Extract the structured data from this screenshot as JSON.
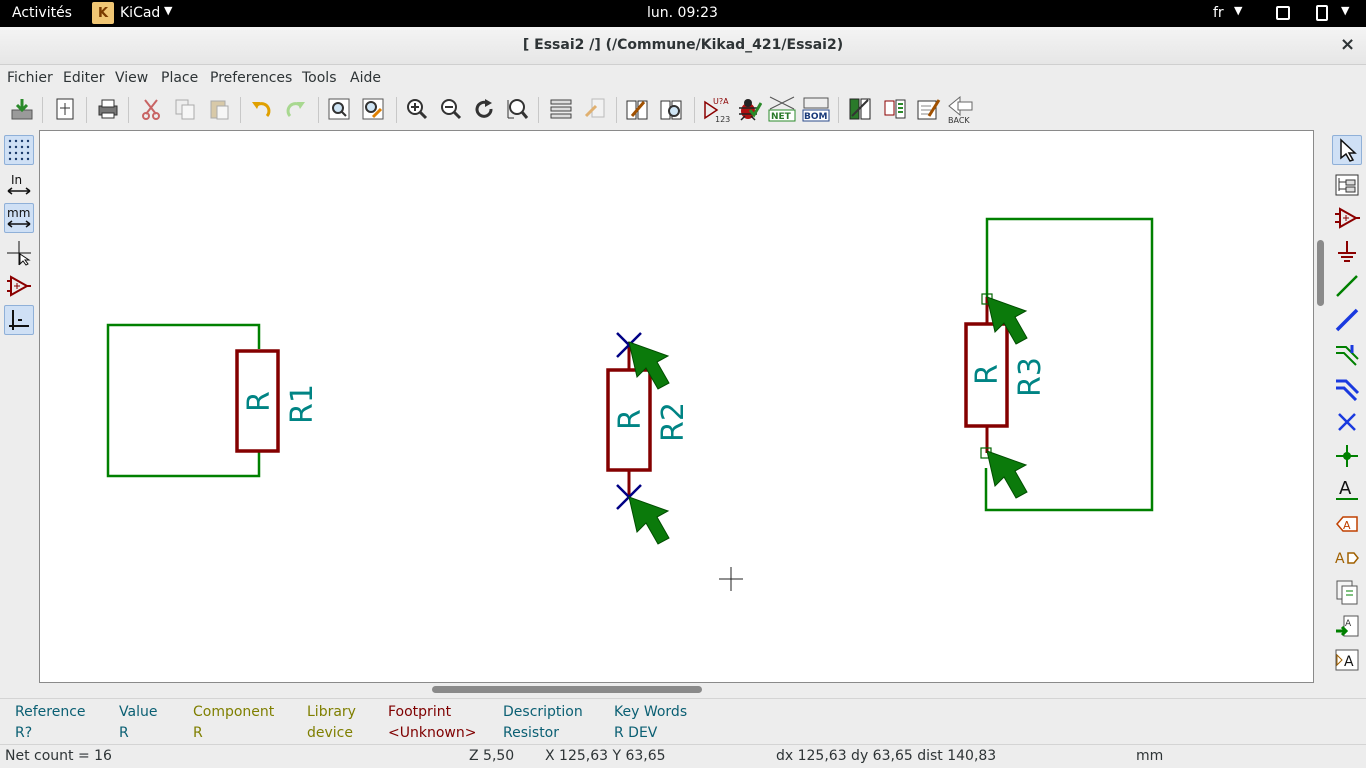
{
  "topbar": {
    "activities": "Activités",
    "app_name": "KiCad",
    "clock": "lun. 09:23",
    "language": "fr"
  },
  "window": {
    "title": "[ Essai2 /] (/Commune/Kikad_421/Essai2)",
    "close_glyph": "×"
  },
  "menu": [
    "Fichier",
    "Editer",
    "View",
    "Place",
    "Preferences",
    "Tools",
    "Aide"
  ],
  "toolbar": {
    "annotate_top": "U?A",
    "annotate_bottom": "123",
    "netlist_label": "NET",
    "bom_label": "BOM",
    "back_label": "BACK"
  },
  "left_toolbar": {
    "inch_label": "In",
    "mm_label": "mm"
  },
  "right_toolbar": {
    "text_label": "A",
    "text_label2": "A"
  },
  "schematic": {
    "components": [
      {
        "reference": "R1",
        "value": "R"
      },
      {
        "reference": "R2",
        "value": "R"
      },
      {
        "reference": "R3",
        "value": "R"
      }
    ],
    "colors": {
      "wire": "#008000",
      "body": "#840000",
      "field_text": "#008484",
      "no_connect": "#000084",
      "erc_arrow": "#006400"
    }
  },
  "message_panel": [
    {
      "header": "Reference",
      "value": "R?",
      "color": "#0a5f73"
    },
    {
      "header": "Value",
      "value": "R",
      "color": "#0a5f73"
    },
    {
      "header": "Component",
      "value": "R",
      "color": "#7f7f00"
    },
    {
      "header": "Library",
      "value": "device",
      "color": "#7f7f00"
    },
    {
      "header": "Footprint",
      "value": "<Unknown>",
      "color": "#7f0000"
    },
    {
      "header": "Description",
      "value": "Resistor",
      "color": "#0a5f73"
    },
    {
      "header": "Key Words",
      "value": "R DEV",
      "color": "#0a5f73"
    }
  ],
  "status": {
    "net_count": "Net count = 16",
    "zoom": "Z 5,50",
    "xy": "X 125,63  Y 63,65",
    "delta": "dx 125,63  dy 63,65  dist 140,83",
    "units": "mm"
  }
}
